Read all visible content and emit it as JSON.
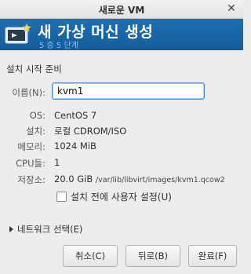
{
  "window": {
    "title": "새로운 VM"
  },
  "banner": {
    "heading": "새 가상 머신 생성",
    "step": "5 중 5 단계",
    "icon": "monitor-star-icon"
  },
  "section_title": "설치 시작 준비",
  "name": {
    "label": "이름(N):",
    "value": "kvm1"
  },
  "details": {
    "os": {
      "label": "OS:",
      "value": "CentOS 7"
    },
    "install": {
      "label": "설치:",
      "value": "로컬 CDROM/ISO"
    },
    "memory": {
      "label": "메모리:",
      "value": "1024 MiB"
    },
    "cpus": {
      "label": "CPU들:",
      "value": "1"
    },
    "storage": {
      "label": "저장소:",
      "size": "20.0 GiB",
      "path": "/var/lib/libvirt/images/kvm1.qcow2"
    }
  },
  "customize_checkbox": {
    "label": "설치 전에 사용자 설정(U)",
    "checked": false
  },
  "network_expander": {
    "label": "네트워크 선택(E)"
  },
  "buttons": {
    "cancel": "취소(C)",
    "back": "뒤로(B)",
    "finish": "완료(F)"
  },
  "colors": {
    "banner": "#1d6fb4",
    "step_text": "#7ec3f0"
  }
}
